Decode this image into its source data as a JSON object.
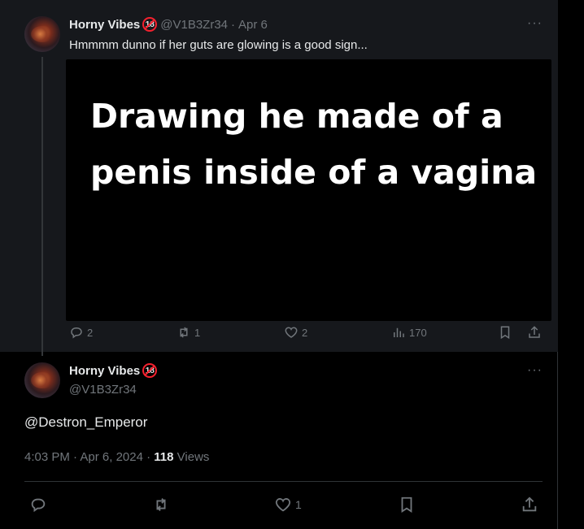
{
  "parent_tweet": {
    "display_name": "Horny Vibes",
    "badge": "18",
    "handle": "@V1B3Zr34",
    "separator": "·",
    "date": "Apr 6",
    "text": "Hmmmm dunno if her guts are glowing is a good sign...",
    "media_text": "Drawing he made of a penis inside of a vagina",
    "more": "···",
    "actions": {
      "replies": "2",
      "reposts": "1",
      "likes": "2",
      "views": "170"
    }
  },
  "main_tweet": {
    "display_name": "Horny Vibes",
    "badge": "18",
    "handle": "@V1B3Zr34",
    "more": "···",
    "text": "@Destron_Emperor",
    "time": "4:03 PM",
    "separator": "·",
    "date": "Apr 6, 2024",
    "views_count": "118",
    "views_label": "Views",
    "actions": {
      "likes": "1"
    }
  },
  "colors": {
    "background": "#000000",
    "parent_background": "#16181c",
    "text": "#e7e9ea",
    "muted": "#71767b",
    "badge_red": "#f4212e",
    "border": "#2f3336"
  },
  "icons": [
    "reply-icon",
    "repost-icon",
    "like-icon",
    "views-icon",
    "bookmark-icon",
    "share-icon",
    "more-icon",
    "age-restricted-badge-icon"
  ]
}
